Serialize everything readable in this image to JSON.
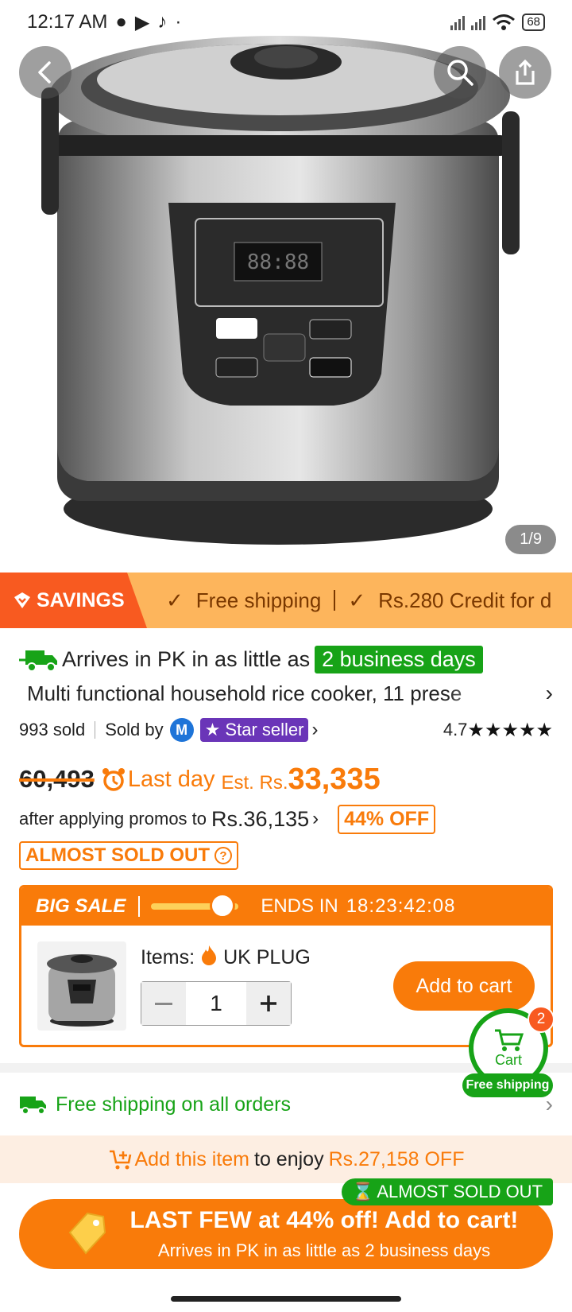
{
  "status_bar": {
    "time": "12:17 AM",
    "battery": "68"
  },
  "hero": {
    "image_counter": "1/9"
  },
  "savings_strip": {
    "tag": "SAVINGS",
    "items": [
      "Free shipping",
      "Rs.280 Credit for d"
    ]
  },
  "delivery": {
    "prefix": "Arrives in PK in as little as",
    "highlight": "2 business days"
  },
  "product": {
    "title": "Multi functional household rice cooker, 11 prese",
    "sold": "993 sold",
    "sold_by": "Sold by",
    "seller_badge": "Star seller",
    "rating": "4.7"
  },
  "price": {
    "original": "60,493",
    "last_day": "Last day",
    "est_label": "Est. Rs.",
    "est_value": "33,335",
    "promo_text": "after applying promos to",
    "promo_price": "Rs.36,135",
    "discount": "44% OFF",
    "almost_sold_out": "ALMOST SOLD OUT"
  },
  "sale": {
    "title": "BIG SALE",
    "ends_label": "ENDS IN",
    "countdown": "18:23:42:08",
    "items_label": "Items:",
    "variant": "UK PLUG",
    "quantity": "1",
    "add_to_cart": "Add to cart"
  },
  "cart": {
    "label": "Cart",
    "count": "2",
    "free_shipping": "Free shipping"
  },
  "shipping": {
    "text": "Free shipping on all orders"
  },
  "promo_bar": {
    "link": "Add this item",
    "middle": "to enjoy",
    "amount": "Rs.27,158 OFF"
  },
  "bottom_badge": "ALMOST SOLD OUT",
  "cta": {
    "line1": "LAST FEW at 44% off! Add to cart!",
    "line2": "Arrives in PK in as little as 2 business days"
  },
  "colors": {
    "accent": "#f97b0a",
    "green": "#17a317",
    "savings_bg": "#fdb55c"
  }
}
